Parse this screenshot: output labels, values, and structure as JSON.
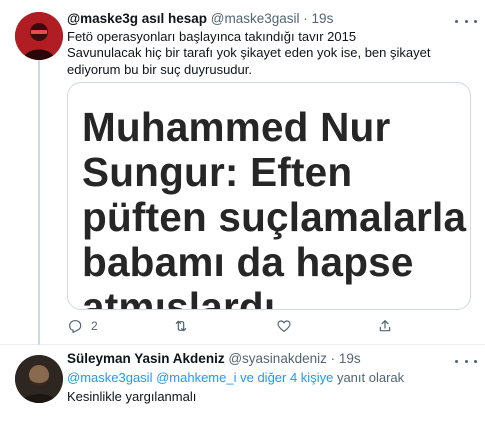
{
  "tweet1": {
    "display_name": "@maske3g asıl hesap",
    "handle": "@maske3gasil",
    "separator": "·",
    "time": "19s",
    "line1": "Fetö operasyonları başlayınca takındığı tavır 2015",
    "line2": "Savunulacak hiç bir tarafı yok şikayet eden yok ise, ben şikayet ediyorum bu bir suç duyrusudur.",
    "media_lines": [
      "Muhammed Nur",
      "Sungur: Eften",
      "püften suçlamalarla",
      "babamı da hapse",
      "atmışlardı"
    ],
    "actions": {
      "reply_count": "2",
      "retweet_count": "",
      "like_count": ""
    }
  },
  "tweet2": {
    "display_name": "Süleyman Yasin Akdeniz",
    "handle": "@syasinakdeniz",
    "separator": "·",
    "time": "19s",
    "reply_to": {
      "mention1": "@maske3gasil",
      "mention2": "@mahkeme_i",
      "others": "ve diğer 4 kişiye",
      "suffix": "yanıt olarak"
    },
    "text": "Kesinlikle yargılanmalı"
  },
  "icons": [
    "reply-icon",
    "retweet-icon",
    "like-icon",
    "share-icon",
    "more-icon"
  ],
  "colors": {
    "link": "#1d9bf0",
    "secondary": "#536471",
    "avatar1": "#b01d22"
  }
}
